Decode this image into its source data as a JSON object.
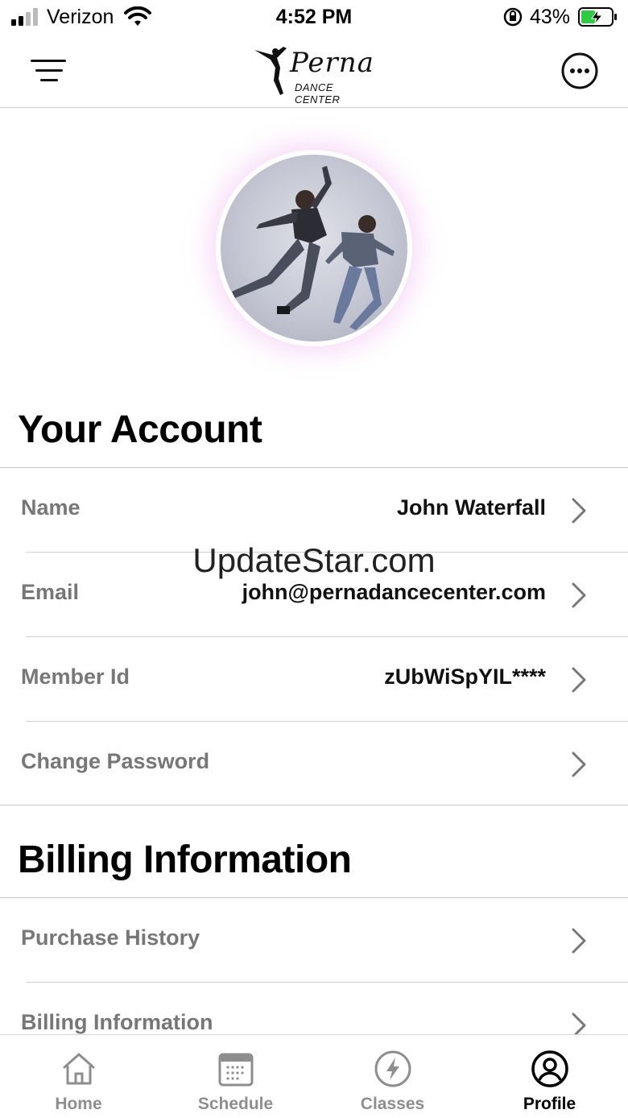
{
  "status_bar": {
    "carrier": "Verizon",
    "time": "4:52 PM",
    "battery_percent": "43%"
  },
  "header": {
    "logo_script": "Perna",
    "logo_subtitle": "DANCE CENTER"
  },
  "watermark": "UpdateStar.com",
  "account_section": {
    "title": "Your Account",
    "rows": [
      {
        "label": "Name",
        "value": "John Waterfall"
      },
      {
        "label": "Email",
        "value": "john@pernadancecenter.com"
      },
      {
        "label": "Member Id",
        "value": "zUbWiSpYIL****"
      },
      {
        "label": "Change Password",
        "value": ""
      }
    ]
  },
  "billing_section": {
    "title": "Billing Information",
    "rows": [
      {
        "label": "Purchase History"
      },
      {
        "label": "Billing Information"
      }
    ]
  },
  "tabs": [
    {
      "label": "Home",
      "icon": "home-icon",
      "active": false
    },
    {
      "label": "Schedule",
      "icon": "calendar-icon",
      "active": false
    },
    {
      "label": "Classes",
      "icon": "lightning-icon",
      "active": false
    },
    {
      "label": "Profile",
      "icon": "profile-icon",
      "active": true
    }
  ],
  "colors": {
    "label_gray": "#777777",
    "tab_inactive": "#8e8e8e",
    "tab_active": "#000000"
  }
}
